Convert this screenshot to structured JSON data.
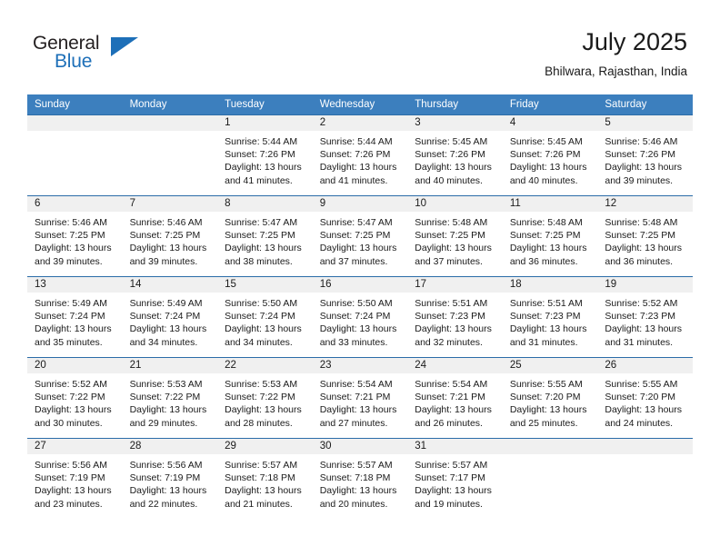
{
  "brand": {
    "name_top": "General",
    "name_bottom": "Blue",
    "accent_color": "#1d6fb8"
  },
  "header": {
    "title": "July 2025",
    "subtitle": "Bhilwara, Rajasthan, India"
  },
  "theme": {
    "header_row_bg": "#3c7fbe",
    "row_divider": "#2b6ca8",
    "daynum_bg": "#f0f0f0"
  },
  "calendar": {
    "day_headers": [
      "Sunday",
      "Monday",
      "Tuesday",
      "Wednesday",
      "Thursday",
      "Friday",
      "Saturday"
    ],
    "weeks": [
      [
        {
          "day": "",
          "sunrise": "",
          "sunset": "",
          "daylight": ""
        },
        {
          "day": "",
          "sunrise": "",
          "sunset": "",
          "daylight": ""
        },
        {
          "day": "1",
          "sunrise": "Sunrise: 5:44 AM",
          "sunset": "Sunset: 7:26 PM",
          "daylight": "Daylight: 13 hours and 41 minutes."
        },
        {
          "day": "2",
          "sunrise": "Sunrise: 5:44 AM",
          "sunset": "Sunset: 7:26 PM",
          "daylight": "Daylight: 13 hours and 41 minutes."
        },
        {
          "day": "3",
          "sunrise": "Sunrise: 5:45 AM",
          "sunset": "Sunset: 7:26 PM",
          "daylight": "Daylight: 13 hours and 40 minutes."
        },
        {
          "day": "4",
          "sunrise": "Sunrise: 5:45 AM",
          "sunset": "Sunset: 7:26 PM",
          "daylight": "Daylight: 13 hours and 40 minutes."
        },
        {
          "day": "5",
          "sunrise": "Sunrise: 5:46 AM",
          "sunset": "Sunset: 7:26 PM",
          "daylight": "Daylight: 13 hours and 39 minutes."
        }
      ],
      [
        {
          "day": "6",
          "sunrise": "Sunrise: 5:46 AM",
          "sunset": "Sunset: 7:25 PM",
          "daylight": "Daylight: 13 hours and 39 minutes."
        },
        {
          "day": "7",
          "sunrise": "Sunrise: 5:46 AM",
          "sunset": "Sunset: 7:25 PM",
          "daylight": "Daylight: 13 hours and 39 minutes."
        },
        {
          "day": "8",
          "sunrise": "Sunrise: 5:47 AM",
          "sunset": "Sunset: 7:25 PM",
          "daylight": "Daylight: 13 hours and 38 minutes."
        },
        {
          "day": "9",
          "sunrise": "Sunrise: 5:47 AM",
          "sunset": "Sunset: 7:25 PM",
          "daylight": "Daylight: 13 hours and 37 minutes."
        },
        {
          "day": "10",
          "sunrise": "Sunrise: 5:48 AM",
          "sunset": "Sunset: 7:25 PM",
          "daylight": "Daylight: 13 hours and 37 minutes."
        },
        {
          "day": "11",
          "sunrise": "Sunrise: 5:48 AM",
          "sunset": "Sunset: 7:25 PM",
          "daylight": "Daylight: 13 hours and 36 minutes."
        },
        {
          "day": "12",
          "sunrise": "Sunrise: 5:48 AM",
          "sunset": "Sunset: 7:25 PM",
          "daylight": "Daylight: 13 hours and 36 minutes."
        }
      ],
      [
        {
          "day": "13",
          "sunrise": "Sunrise: 5:49 AM",
          "sunset": "Sunset: 7:24 PM",
          "daylight": "Daylight: 13 hours and 35 minutes."
        },
        {
          "day": "14",
          "sunrise": "Sunrise: 5:49 AM",
          "sunset": "Sunset: 7:24 PM",
          "daylight": "Daylight: 13 hours and 34 minutes."
        },
        {
          "day": "15",
          "sunrise": "Sunrise: 5:50 AM",
          "sunset": "Sunset: 7:24 PM",
          "daylight": "Daylight: 13 hours and 34 minutes."
        },
        {
          "day": "16",
          "sunrise": "Sunrise: 5:50 AM",
          "sunset": "Sunset: 7:24 PM",
          "daylight": "Daylight: 13 hours and 33 minutes."
        },
        {
          "day": "17",
          "sunrise": "Sunrise: 5:51 AM",
          "sunset": "Sunset: 7:23 PM",
          "daylight": "Daylight: 13 hours and 32 minutes."
        },
        {
          "day": "18",
          "sunrise": "Sunrise: 5:51 AM",
          "sunset": "Sunset: 7:23 PM",
          "daylight": "Daylight: 13 hours and 31 minutes."
        },
        {
          "day": "19",
          "sunrise": "Sunrise: 5:52 AM",
          "sunset": "Sunset: 7:23 PM",
          "daylight": "Daylight: 13 hours and 31 minutes."
        }
      ],
      [
        {
          "day": "20",
          "sunrise": "Sunrise: 5:52 AM",
          "sunset": "Sunset: 7:22 PM",
          "daylight": "Daylight: 13 hours and 30 minutes."
        },
        {
          "day": "21",
          "sunrise": "Sunrise: 5:53 AM",
          "sunset": "Sunset: 7:22 PM",
          "daylight": "Daylight: 13 hours and 29 minutes."
        },
        {
          "day": "22",
          "sunrise": "Sunrise: 5:53 AM",
          "sunset": "Sunset: 7:22 PM",
          "daylight": "Daylight: 13 hours and 28 minutes."
        },
        {
          "day": "23",
          "sunrise": "Sunrise: 5:54 AM",
          "sunset": "Sunset: 7:21 PM",
          "daylight": "Daylight: 13 hours and 27 minutes."
        },
        {
          "day": "24",
          "sunrise": "Sunrise: 5:54 AM",
          "sunset": "Sunset: 7:21 PM",
          "daylight": "Daylight: 13 hours and 26 minutes."
        },
        {
          "day": "25",
          "sunrise": "Sunrise: 5:55 AM",
          "sunset": "Sunset: 7:20 PM",
          "daylight": "Daylight: 13 hours and 25 minutes."
        },
        {
          "day": "26",
          "sunrise": "Sunrise: 5:55 AM",
          "sunset": "Sunset: 7:20 PM",
          "daylight": "Daylight: 13 hours and 24 minutes."
        }
      ],
      [
        {
          "day": "27",
          "sunrise": "Sunrise: 5:56 AM",
          "sunset": "Sunset: 7:19 PM",
          "daylight": "Daylight: 13 hours and 23 minutes."
        },
        {
          "day": "28",
          "sunrise": "Sunrise: 5:56 AM",
          "sunset": "Sunset: 7:19 PM",
          "daylight": "Daylight: 13 hours and 22 minutes."
        },
        {
          "day": "29",
          "sunrise": "Sunrise: 5:57 AM",
          "sunset": "Sunset: 7:18 PM",
          "daylight": "Daylight: 13 hours and 21 minutes."
        },
        {
          "day": "30",
          "sunrise": "Sunrise: 5:57 AM",
          "sunset": "Sunset: 7:18 PM",
          "daylight": "Daylight: 13 hours and 20 minutes."
        },
        {
          "day": "31",
          "sunrise": "Sunrise: 5:57 AM",
          "sunset": "Sunset: 7:17 PM",
          "daylight": "Daylight: 13 hours and 19 minutes."
        },
        {
          "day": "",
          "sunrise": "",
          "sunset": "",
          "daylight": ""
        },
        {
          "day": "",
          "sunrise": "",
          "sunset": "",
          "daylight": ""
        }
      ]
    ]
  }
}
